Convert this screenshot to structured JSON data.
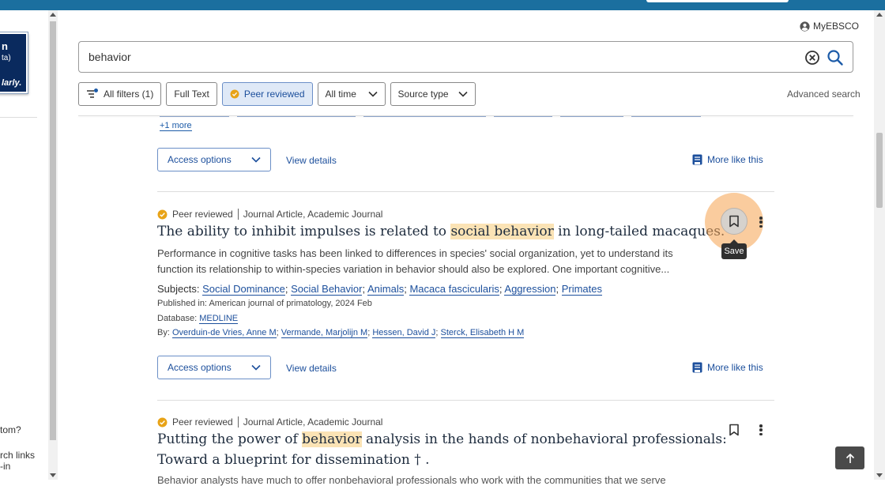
{
  "left_panel": {
    "promo_line1": "n",
    "promo_line2": "ta)",
    "promo_line3": "larly.",
    "text_a": "tom?",
    "text_b": "rch links",
    "text_c": "-in"
  },
  "header": {
    "account_label": "MyEBSCO",
    "search_value": "behavior",
    "filters": {
      "all_filters": "All filters (1)",
      "full_text": "Full Text",
      "peer_reviewed": "Peer reviewed",
      "all_time": "All time",
      "source_type": "Source type"
    },
    "advanced_search": "Advanced search"
  },
  "prev_result": {
    "more_link": "+1 more",
    "access_options": "Access options",
    "view_details": "View details",
    "more_like_this": "More like this"
  },
  "result": {
    "badge": "Peer reviewed",
    "type": "Journal Article, Academic Journal",
    "title_pre": "The ability to inhibit impulses is related to ",
    "title_hl": "social behavior",
    "title_post": " in long-tailed macaques.",
    "abstract": "Performance in cognitive tasks has been linked to differences in species' social organization, yet to understand its function its relationship to within-species variation in behavior should also be explored. One important cognitive...",
    "subjects_label": "Subjects:",
    "subjects": [
      "Social Dominance",
      "Social Behavior",
      "Animals",
      "Macaca fascicularis",
      "Aggression",
      "Primates"
    ],
    "published_label": "Published in:",
    "published_value": "American journal of primatology, 2024 Feb",
    "database_label": "Database:",
    "database_value": "MEDLINE",
    "by_label": "By:",
    "authors": [
      "Overduin-de Vries, Anne M",
      "Vermande, Marjolijn M",
      "Hessen, David J",
      "Sterck, Elisabeth H M"
    ],
    "save_tooltip": "Save",
    "access_options": "Access options",
    "view_details": "View details",
    "more_like_this": "More like this"
  },
  "next_result": {
    "badge": "Peer reviewed",
    "type": "Journal Article, Academic Journal",
    "title_pre": "Putting the power of ",
    "title_hl": "behavior",
    "title_post": " analysis in the hands of nonbehavioral professionals:",
    "title_line2": "Toward a blueprint for dissemination † .",
    "abstract_cut": "Behavior analysts have much to offer nonbehavioral professionals who work with the communities that we serve"
  },
  "colors": {
    "topbar": "#1b6f9f",
    "link": "#1c4f9c",
    "highlight": "#fbe3b5",
    "save_halo": "#f6a24e",
    "peer_badge": "#e8a317"
  }
}
